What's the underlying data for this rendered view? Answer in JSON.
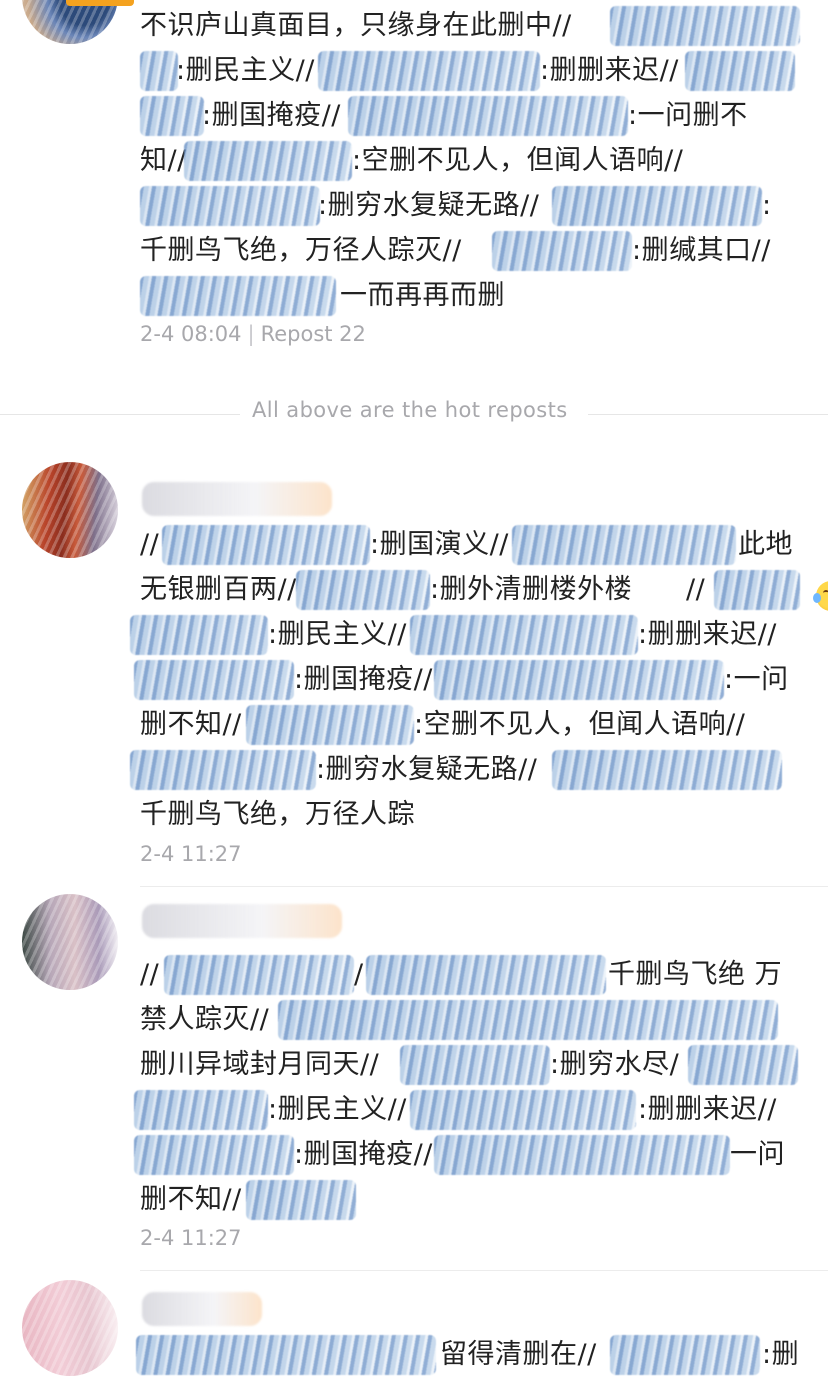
{
  "posts": [
    {
      "lines": [
        "不识庐山真面目，只缘身在此删中//",
        ":删民主义//",
        ":删删来迟//",
        ":删国掩疫//",
        ":一问删不",
        "知//",
        ":空删不见人，但闻人语响//",
        ":删穷水复疑无路//",
        ":",
        "千删鸟飞绝，万径人踪灭//",
        ":删缄其口//",
        "一而再再而删"
      ],
      "time": "2-4 08:04",
      "repost_label": "Repost 22"
    },
    {
      "lines": [
        "//",
        ":删国演义//",
        "此地",
        "无银删百两//",
        ":删外清删楼外楼",
        "//",
        ":删民主义//",
        ":删删来迟//",
        ":删国掩疫//",
        ":一问",
        "删不知//",
        ":空删不见人，但闻人语响//",
        ":删穷水复疑无路//",
        "千删鸟飞绝，万径人踪"
      ],
      "time": "2-4 11:27"
    },
    {
      "lines": [
        "//",
        "/",
        "千删鸟飞绝 万",
        "禁人踪灭//",
        "删川异域封月同天//",
        ":删穷水尽/",
        ":删民主义//",
        ":删删来迟//",
        ":删国掩疫//",
        "一问",
        "删不知//"
      ],
      "time": "2-4 11:27"
    },
    {
      "lines": [
        "留得清删在//",
        ":删"
      ]
    }
  ],
  "hot_separator": "All above are the hot reposts",
  "emoji_name": "tears-of-joy-emoji"
}
